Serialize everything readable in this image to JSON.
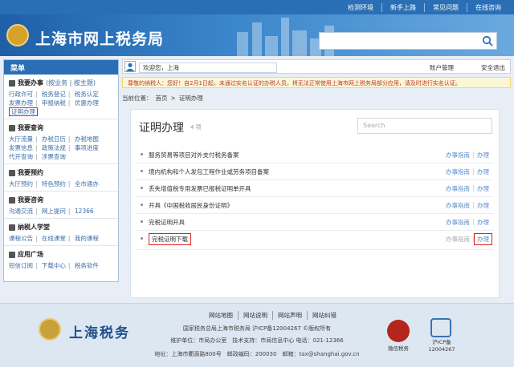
{
  "topbar": {
    "links": [
      "检测环境",
      "新手上路",
      "常见问题",
      "在线咨询"
    ]
  },
  "header": {
    "site_name": "上海市网上税务局"
  },
  "sidebar": {
    "title": "菜单",
    "sections": [
      {
        "heading": "我要办事",
        "heading_extra": "(按业务 | 按主题)",
        "rows": [
          [
            "行政许可",
            "税务登记",
            "税务认定"
          ],
          [
            "发票办理",
            "申报纳税",
            "优惠办理"
          ]
        ],
        "highlight": "证明办理"
      },
      {
        "heading": "我要查询",
        "rows": [
          [
            "大厅流量",
            "办税日历",
            "办税地图"
          ],
          [
            "发票信息",
            "政策法规",
            "事项进度"
          ],
          [
            "代开查询",
            "涉票查询"
          ]
        ]
      },
      {
        "heading": "我要预约",
        "rows": [
          [
            "大厅预约",
            "特色预约",
            "全市通办"
          ]
        ]
      },
      {
        "heading": "我要咨询",
        "rows": [
          [
            "沟通交流",
            "网上提问",
            "12366"
          ]
        ]
      },
      {
        "heading": "纳税人学堂",
        "rows": [
          [
            "课程公告",
            "在线课堂",
            "我的课程"
          ]
        ]
      },
      {
        "heading": "应用广场",
        "rows": [
          [
            "短信订阅",
            "下载中心",
            "税务软件"
          ]
        ]
      }
    ]
  },
  "welcome": {
    "greeting": "欢迎您，上海",
    "account": "账户管理",
    "security": "安全退出"
  },
  "notice": "尊敬的纳税人：您好！自2月1日起，未通过实名认证的办税人员，将无法正常使用上海市网上税务局部分应用，请及时进行实名认证。",
  "breadcrumb": {
    "prefix": "当前位置：",
    "home": "首页",
    "sep": ">",
    "current": "证明办理"
  },
  "panel": {
    "title": "证明办理",
    "count": "4 项",
    "search_placeholder": "Search",
    "guide_label": "办事指南",
    "do_label": "办理",
    "items": [
      "服务贸易等项目对外支付税务备案",
      "境内机构和个人发包工程作业或劳务项目备案",
      "丢失增值税专用发票已报税证明单开具",
      "开具《中国税收居民身份证明》",
      "完税证明开具",
      "完税证明下载"
    ]
  },
  "footer": {
    "links": [
      "网站地图",
      "网站说明",
      "网站声明",
      "网站纠错"
    ],
    "logo_text": "上海税务",
    "line1": "国家税务总局上海市税务局 沪ICP备12004267 ©版权所有",
    "line2": "维护单位：市局办公室　技术支持：市局信息中心 电话：021-12366",
    "line3": "地址：上海市衢源路800号　邮政编码：200030　邮箱：tax@shanghai.gov.cn",
    "badge1_label": "微信税务",
    "badge2_label": "沪ICP备 12004267"
  },
  "colors": {
    "brand_blue": "#2a6fb5",
    "alert_red": "#e02020",
    "notice_bg": "#fbf6d6"
  }
}
